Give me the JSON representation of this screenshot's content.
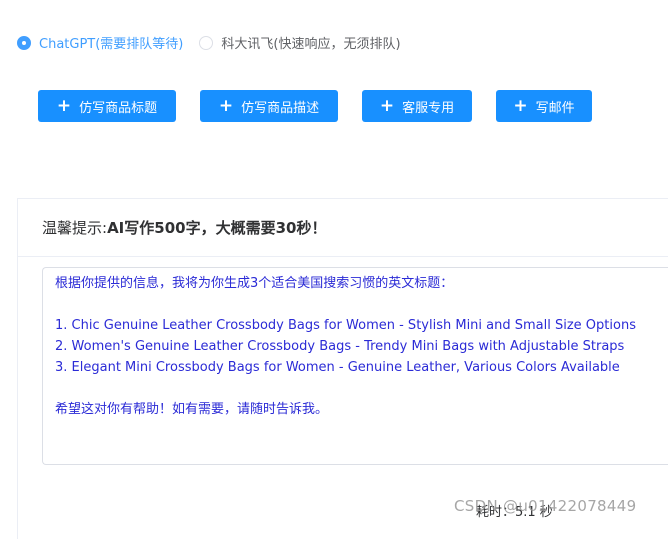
{
  "engine_options": [
    {
      "label": "ChatGPT(需要排队等待)",
      "selected": true
    },
    {
      "label": "科大讯飞(快速响应，无须排队)",
      "selected": false
    }
  ],
  "action_buttons": [
    {
      "label": "仿写商品标题"
    },
    {
      "label": "仿写商品描述"
    },
    {
      "label": "客服专用"
    },
    {
      "label": "写邮件"
    }
  ],
  "notice": {
    "prefix": "温馨提示: ",
    "emphasis": "AI写作500字，大概需要30秒！"
  },
  "output": {
    "intro": "根据你提供的信息，我将为你生成3个适合美国搜索习惯的英文标题：",
    "items": [
      "1. Chic Genuine Leather Crossbody Bags for Women - Stylish Mini and Small Size Options",
      "2. Women's Genuine Leather Crossbody Bags - Trendy Mini Bags with Adjustable Straps",
      "3. Elegant Mini Crossbody Bags for Women - Genuine Leather, Various Colors Available"
    ],
    "closing": "希望这对你有帮助！如有需要，请随时告诉我。"
  },
  "timer_text": "耗时：5.1 秒",
  "watermark": "CSDN @u014220784​49",
  "colors": {
    "primary": "#1890ff",
    "output_text": "#2b2bd6"
  }
}
